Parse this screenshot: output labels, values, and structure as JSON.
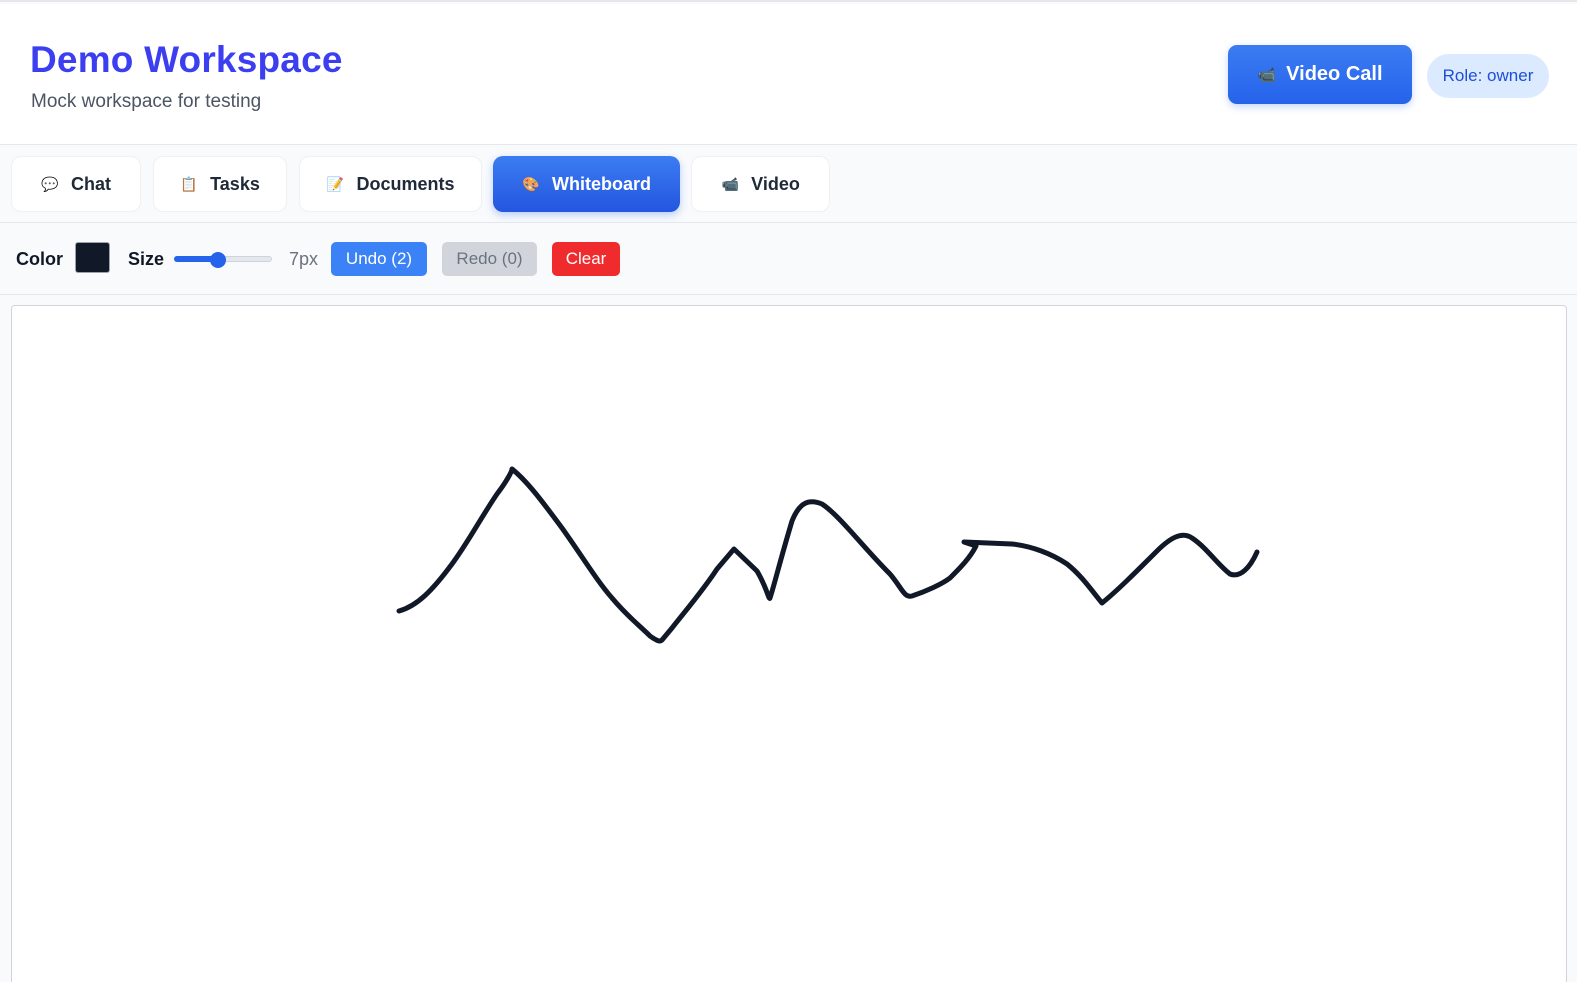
{
  "header": {
    "title": "Demo Workspace",
    "subtitle": "Mock workspace for testing",
    "video_call_label": "Video Call",
    "video_call_icon": "video-camera-icon",
    "role_label": "Role: owner"
  },
  "tabs": [
    {
      "label": "Chat",
      "icon": "speech-bubble-icon",
      "glyph": "💬",
      "active": false
    },
    {
      "label": "Tasks",
      "icon": "clipboard-icon",
      "glyph": "📋",
      "active": false
    },
    {
      "label": "Documents",
      "icon": "memo-icon",
      "glyph": "📝",
      "active": false
    },
    {
      "label": "Whiteboard",
      "icon": "palette-icon",
      "glyph": "🎨",
      "active": true
    },
    {
      "label": "Video",
      "icon": "video-camera-icon",
      "glyph": "📹",
      "active": false
    }
  ],
  "toolbar": {
    "color_label": "Color",
    "color_value": "#111827",
    "size_label": "Size",
    "size_value": "7px",
    "size_fraction": 0.45,
    "undo_label": "Undo (2)",
    "redo_label": "Redo (0)",
    "clear_label": "Clear"
  },
  "colors": {
    "accent": "#2563eb",
    "title": "#3b3ff0",
    "danger": "#ef2b2d",
    "stroke": "#111827"
  }
}
